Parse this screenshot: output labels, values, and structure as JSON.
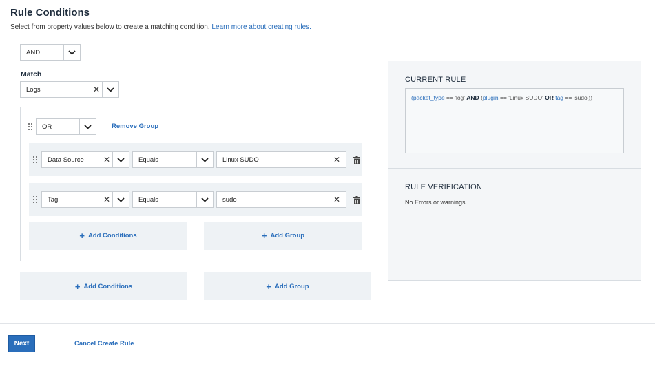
{
  "header": {
    "title": "Rule Conditions",
    "subtitle": "Select from property values below to create a matching condition.",
    "learn_more": "Learn more about creating rules."
  },
  "top_operator": "AND",
  "match": {
    "label": "Match",
    "value": "Logs"
  },
  "group": {
    "operator": "OR",
    "remove_label": "Remove Group",
    "conditions": [
      {
        "field": "Data Source",
        "comparator": "Equals",
        "value": "Linux SUDO"
      },
      {
        "field": "Tag",
        "comparator": "Equals",
        "value": "sudo"
      }
    ],
    "add_conditions": "Add Conditions",
    "add_group": "Add Group"
  },
  "outer_actions": {
    "add_conditions": "Add Conditions",
    "add_group": "Add Group"
  },
  "current_rule": {
    "heading": "CURRENT RULE",
    "parts": {
      "p1": "(packet_type",
      "p2": " == 'log' ",
      "p3": "AND",
      "p4": " (",
      "p5": "plugin",
      "p6": " == 'Linux SUDO' ",
      "p7": "OR",
      "p8": " ",
      "p9": "tag",
      "p10": " == 'sudo'))"
    }
  },
  "verification": {
    "heading": "RULE VERIFICATION",
    "text": "No Errors or warnings"
  },
  "footer": {
    "next": "Next",
    "cancel": "Cancel Create Rule"
  },
  "colors": {
    "accent": "#2a6ebb",
    "panel_bg": "#f4f6f8",
    "row_bg": "#eef2f5"
  }
}
